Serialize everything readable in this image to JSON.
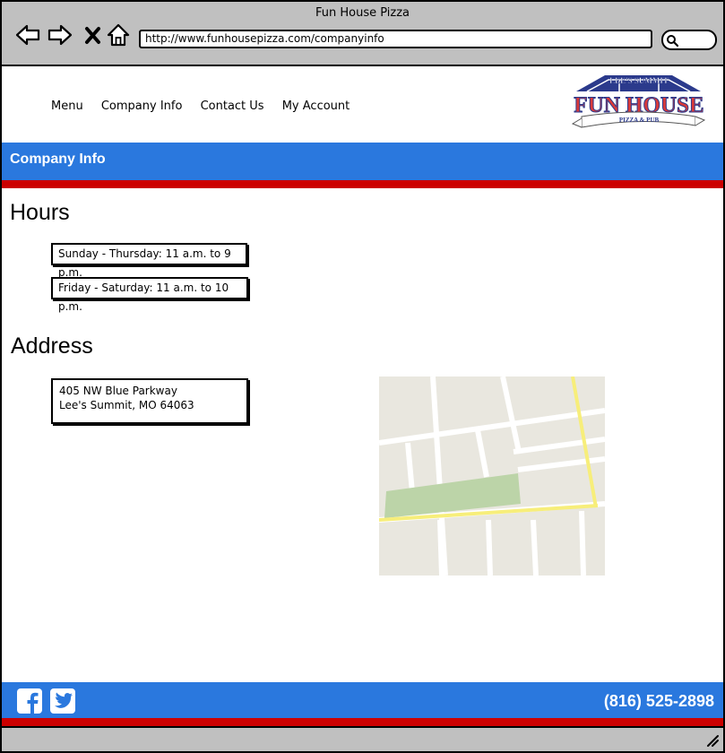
{
  "browser": {
    "window_title": "Fun House Pizza",
    "url": "http://www.funhousepizza.com/companyinfo",
    "icons": [
      "back-icon",
      "forward-icon",
      "close-icon",
      "home-icon",
      "search-icon"
    ]
  },
  "nav": {
    "items": [
      "Menu",
      "Company Info",
      "Contact Us",
      "My Account"
    ]
  },
  "logo": {
    "top_text": "LEE'S SUMMIT",
    "main_text": "FUN HOUSE",
    "bottom_text": "PIZZA & PUB"
  },
  "page": {
    "title": "Company Info",
    "hours_heading": "Hours",
    "hours": [
      "Sunday - Thursday: 11 a.m. to 9 p.m.",
      "Friday - Saturday: 11 a.m. to 10 p.m."
    ],
    "address_heading": "Address",
    "address_line1": "405 NW Blue Parkway",
    "address_line2": "Lee's Summit, MO 64063"
  },
  "footer": {
    "phone": "(816) 525-2898",
    "social": [
      "facebook-icon",
      "twitter-icon"
    ]
  },
  "colors": {
    "brand_blue": "#2a78de",
    "brand_red": "#cc0000",
    "chrome_gray": "#c0c0c0"
  }
}
